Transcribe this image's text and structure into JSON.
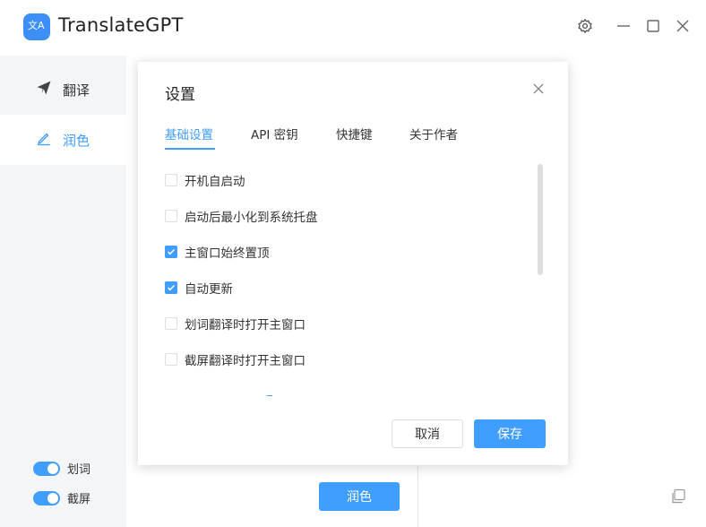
{
  "app": {
    "title": "TranslateGPT",
    "logo_glyph": "文A",
    "accent_color": "#409eff"
  },
  "titlebar": {
    "icons": [
      "settings-icon",
      "minimize-icon",
      "maximize-icon",
      "close-icon"
    ]
  },
  "sidebar": {
    "items": [
      {
        "label": "翻译",
        "icon": "send-icon",
        "active": false
      },
      {
        "label": "润色",
        "icon": "pen-icon",
        "active": true
      }
    ],
    "toggles": [
      {
        "label": "划词",
        "on": true
      },
      {
        "label": "截屏",
        "on": true
      }
    ]
  },
  "main": {
    "polish_button": "润色"
  },
  "dialog": {
    "title": "设置",
    "tabs": [
      {
        "label": "基础设置",
        "active": true
      },
      {
        "label": "API 密钥",
        "active": false
      },
      {
        "label": "快捷键",
        "active": false
      },
      {
        "label": "关于作者",
        "active": false
      }
    ],
    "options": [
      {
        "label": "开机自启动",
        "checked": false
      },
      {
        "label": "启动后最小化到系统托盘",
        "checked": false
      },
      {
        "label": "主窗口始终置顶",
        "checked": true
      },
      {
        "label": "自动更新",
        "checked": true
      },
      {
        "label": "划词翻译时打开主窗口",
        "checked": false
      },
      {
        "label": "截屏翻译时打开主窗口",
        "checked": false
      }
    ],
    "cancel_label": "取消",
    "save_label": "保存"
  }
}
